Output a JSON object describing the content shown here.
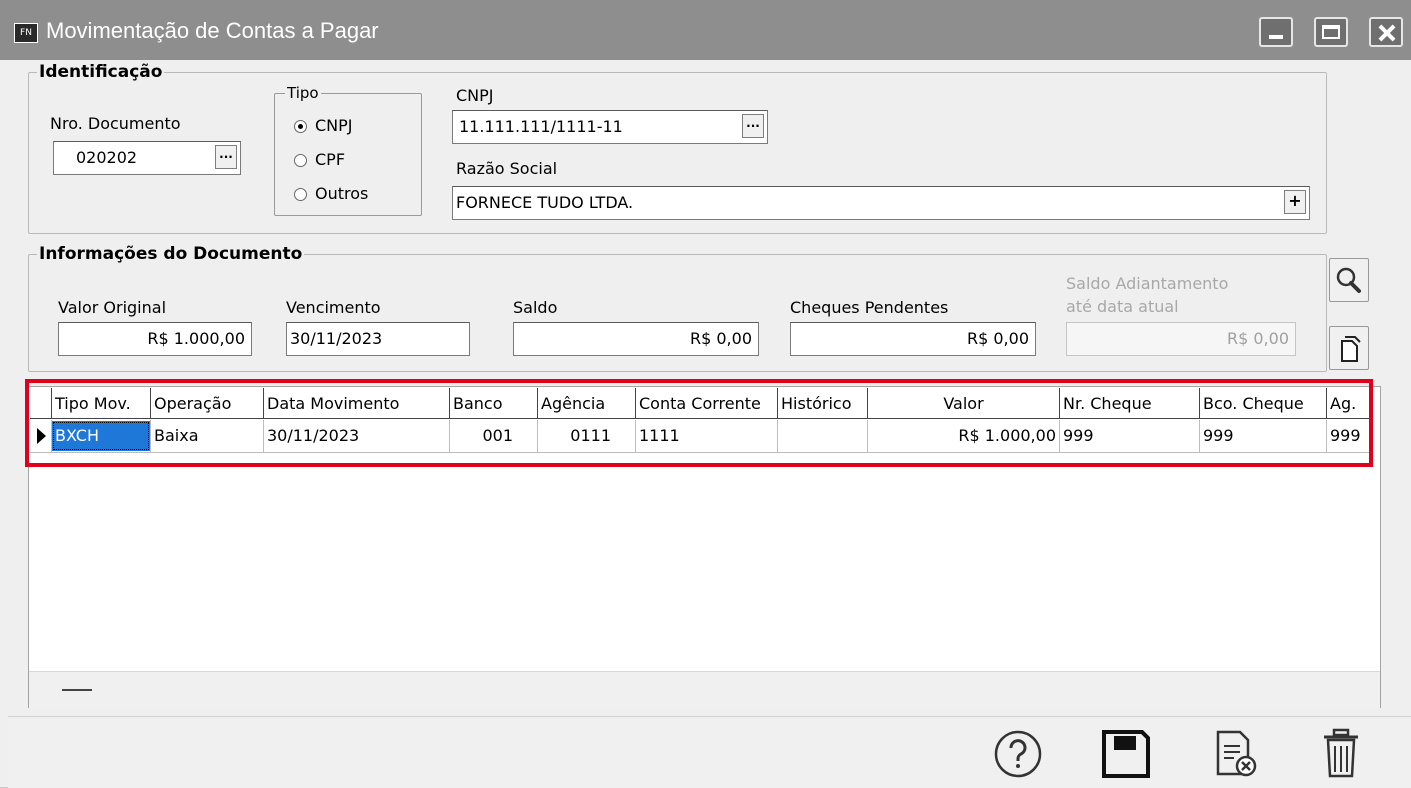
{
  "window": {
    "title": "Movimentação de Contas a Pagar",
    "app_badge": "FN"
  },
  "identificacao": {
    "legend": "Identificação",
    "nro_documento": {
      "label": "Nro. Documento",
      "value": "020202",
      "button": "..."
    },
    "tipo": {
      "legend": "Tipo",
      "options": [
        "CNPJ",
        "CPF",
        "Outros"
      ],
      "selected": "CNPJ"
    },
    "cnpj": {
      "label": "CNPJ",
      "value": "11.111.111/1111-11",
      "button": "..."
    },
    "razao_social": {
      "label": "Razão Social",
      "value": "FORNECE TUDO LTDA.",
      "button": "+"
    }
  },
  "informacoes": {
    "legend": "Informações do Documento",
    "valor_original": {
      "label": "Valor Original",
      "value": "R$ 1.000,00"
    },
    "vencimento": {
      "label": "Vencimento",
      "value": "30/11/2023"
    },
    "saldo": {
      "label": "Saldo",
      "value": "R$ 0,00"
    },
    "cheques_pendentes": {
      "label": "Cheques Pendentes",
      "value": "R$ 0,00"
    },
    "saldo_adiantamento": {
      "label_line1": "Saldo Adiantamento",
      "label_line2": "até data atual",
      "value": "R$ 0,00"
    }
  },
  "side_buttons": [
    "search-icon",
    "copy-document-icon"
  ],
  "grid": {
    "columns": [
      "Tipo Mov.",
      "Operação",
      "Data Movimento",
      "Banco",
      "Agência",
      "Conta Corrente",
      "Histórico",
      "Valor",
      "Nr. Cheque",
      "Bco. Cheque",
      "Ag."
    ],
    "rows": [
      {
        "tipo_mov": "BXCH",
        "operacao": "Baixa",
        "data_movimento": "30/11/2023",
        "banco": "001",
        "agencia": "0111",
        "conta_corrente": "1111",
        "historico": "",
        "valor": "R$ 1.000,00",
        "nr_cheque": "999",
        "bco_cheque": "999",
        "ag": "999"
      }
    ]
  },
  "toolbar": [
    "help-icon",
    "save-icon",
    "cancel-document-icon",
    "trash-icon"
  ],
  "colors": {
    "titlebar": "#8e8e8e",
    "highlight": "#e0001c",
    "selection": "#1e78d8"
  }
}
